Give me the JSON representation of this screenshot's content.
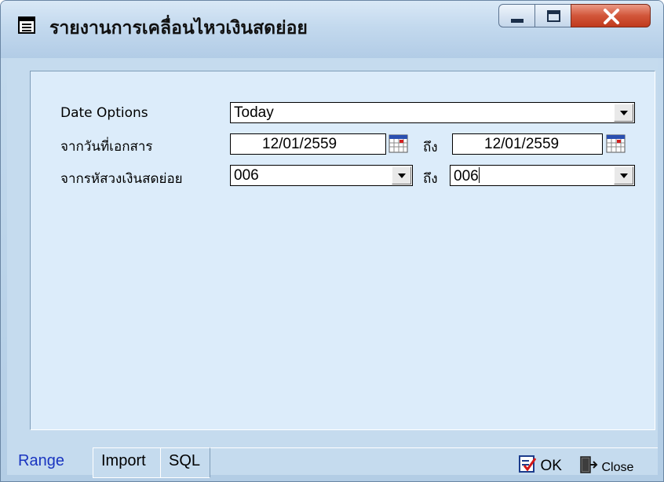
{
  "window": {
    "title": "รายงานการเคลื่อนไหวเงินสดย่อย",
    "title_icon": "report-form-icon",
    "controls": [
      "minimize-icon",
      "maximize-icon",
      "close-icon"
    ]
  },
  "form": {
    "date_options": {
      "label": "Date Options",
      "value": "Today"
    },
    "doc_date": {
      "label": "จากวันที่เอกสาร",
      "from": "12/01/2559",
      "to_label": "ถึง",
      "to": "12/01/2559"
    },
    "petty_cash": {
      "label": "จากรหัสวงเงินสดย่อย",
      "from": "006",
      "to_label": "ถึง",
      "to": "006"
    }
  },
  "tabs": [
    {
      "label": "Range",
      "active": true
    },
    {
      "label": "Import",
      "active": false
    },
    {
      "label": "SQL",
      "active": false
    }
  ],
  "actions": {
    "ok_label": "OK",
    "close_label": "Close"
  },
  "colors": {
    "panel_bg": "#dcecfa",
    "frame_bg": "#c5dbee",
    "active_tab_text": "#1a35c0",
    "close_button": "#c8452a"
  }
}
